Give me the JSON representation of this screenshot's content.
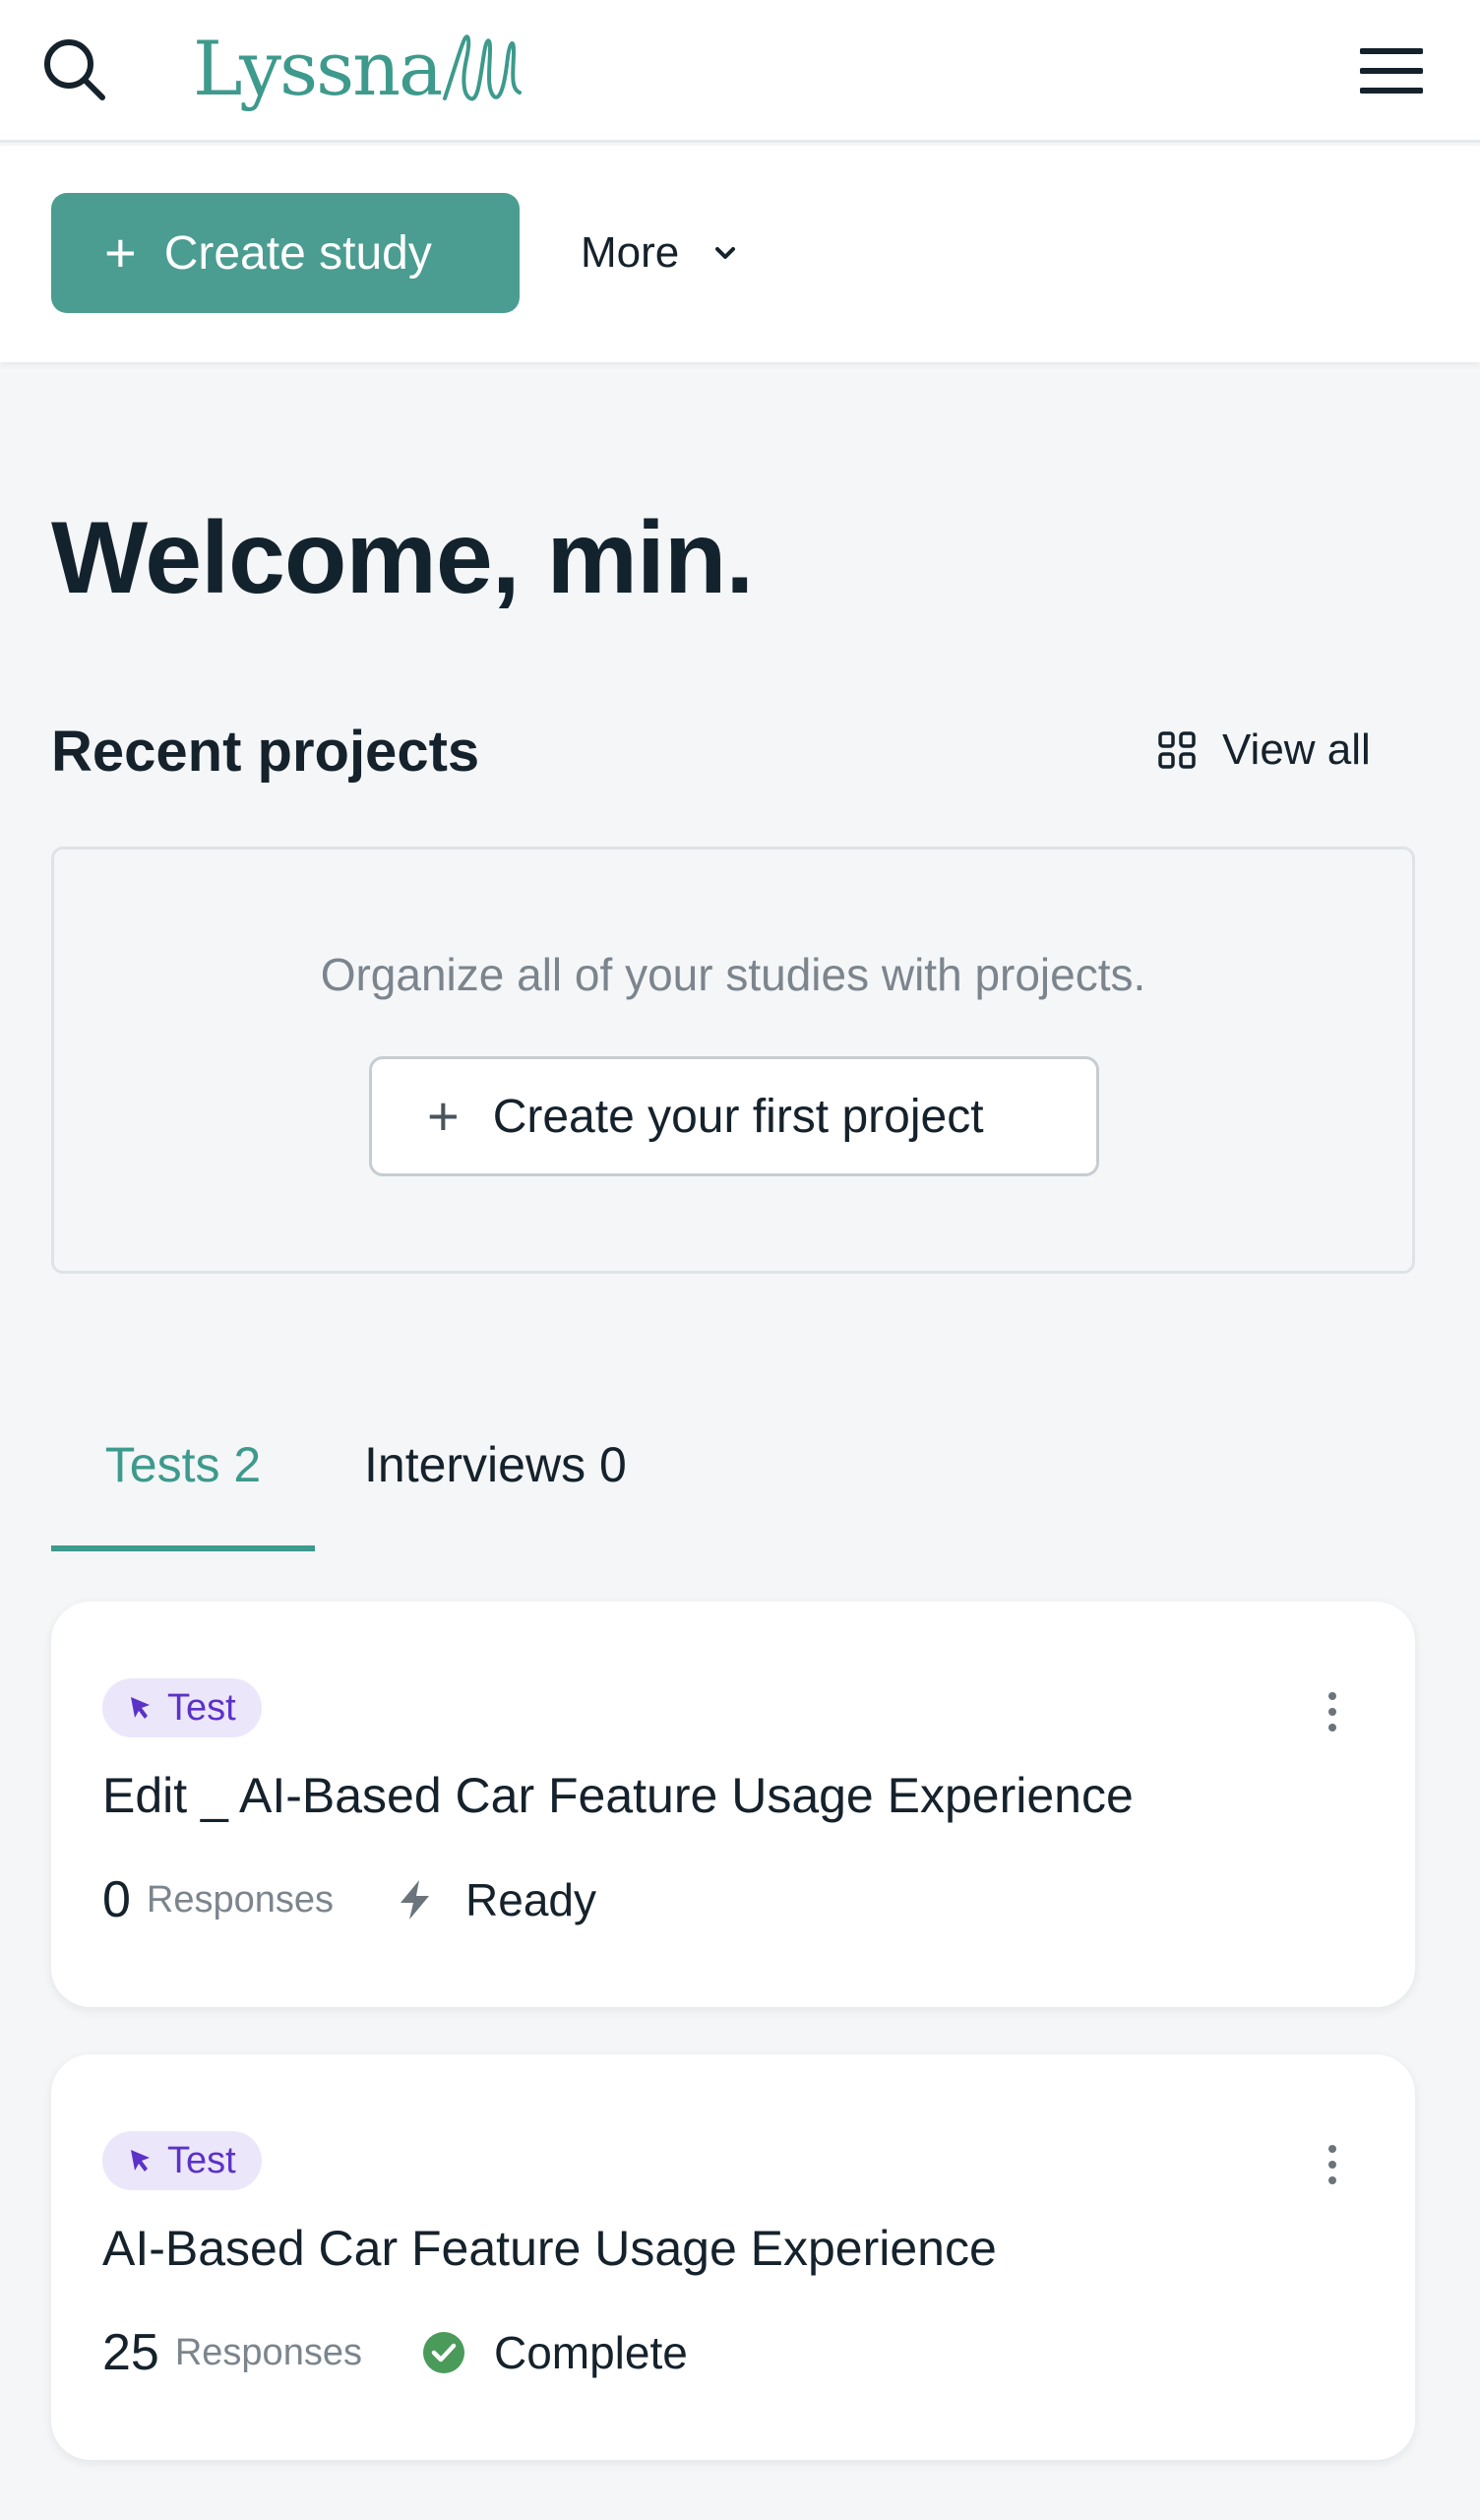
{
  "header": {
    "logo_text": "Lyssna",
    "icons": {
      "search": "search-icon",
      "menu": "hamburger-menu-icon"
    }
  },
  "actions": {
    "create_study_label": "Create study",
    "more_label": "More"
  },
  "welcome": "Welcome, min.",
  "recent_projects": {
    "title": "Recent projects",
    "view_all_label": "View all",
    "empty_message": "Organize all of your studies with projects.",
    "create_first_label": "Create your first project"
  },
  "tabs": [
    {
      "label": "Tests 2",
      "active": true
    },
    {
      "label": "Interviews 0",
      "active": false
    }
  ],
  "studies": [
    {
      "badge": "Test",
      "title": "Edit _ AI-Based Car Feature Usage Experience",
      "responses": "0",
      "responses_label": "Responses",
      "status": "Ready",
      "status_icon": "lightning-icon"
    },
    {
      "badge": "Test",
      "title": "AI-Based Car Feature Usage Experience",
      "responses": "25",
      "responses_label": "Responses",
      "status": "Complete",
      "status_icon": "check-circle-icon"
    }
  ],
  "colors": {
    "brand": "#3d9a8c",
    "button": "#4a9d90",
    "badge_bg": "#ece6fb",
    "badge_text": "#5b32c7",
    "complete": "#4a9a5a"
  }
}
